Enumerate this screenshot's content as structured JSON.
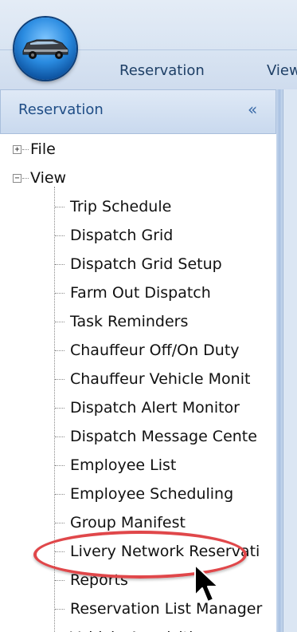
{
  "ribbon": {
    "tabs": [
      "Reservation",
      "View"
    ]
  },
  "panel": {
    "title": "Reservation",
    "collapse_glyph": "«"
  },
  "tree": {
    "roots": [
      {
        "label": "File",
        "expander": "+"
      },
      {
        "label": "View",
        "expander": "−"
      }
    ],
    "view_children": [
      "Trip Schedule",
      "Dispatch Grid",
      "Dispatch Grid Setup",
      "Farm Out Dispatch",
      "Task Reminders",
      "Chauffeur Off/On Duty",
      "Chauffeur Vehicle Monit",
      "Dispatch Alert Monitor",
      "Dispatch Message Cente",
      "Employee List",
      "Employee Scheduling",
      "Group Manifest",
      "Livery Network Reservati",
      "Reports",
      "Reservation List Manager",
      "Vehicle Acquisition"
    ]
  },
  "colors": {
    "highlight": "#e0474a",
    "panel_title": "#1f4d86",
    "ribbon_tab": "#1e3f66"
  }
}
